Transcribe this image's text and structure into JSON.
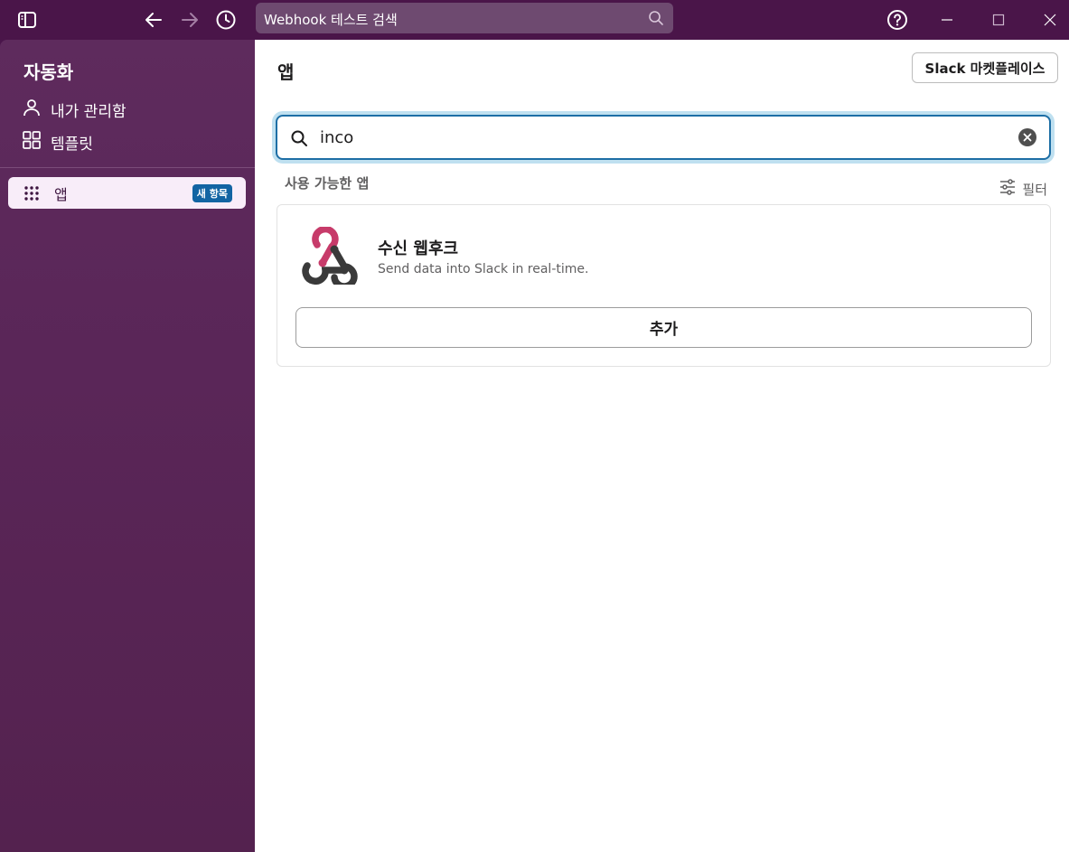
{
  "titlebar": {
    "search_text": "Webhook 테스트 검색",
    "icons": [
      "sidebar-toggle-icon",
      "back-arrow-icon",
      "forward-arrow-icon",
      "history-clock-icon",
      "help-icon",
      "minimize-icon",
      "maximize-icon",
      "close-icon"
    ]
  },
  "sidebar": {
    "title": "자동화",
    "items": [
      {
        "label": "내가 관리함",
        "icon": "person-icon"
      },
      {
        "label": "템플릿",
        "icon": "grid-icon"
      }
    ],
    "active_item": {
      "label": "앱",
      "badge": "새 항목",
      "icon": "dots-grid-icon"
    }
  },
  "main": {
    "title": "앱",
    "marketplace_button": "Slack 마켓플레이스",
    "search_value": "inco",
    "section_label": "사용 가능한 앱",
    "filter_label": "필터",
    "apps": [
      {
        "name": "수신 웹후크",
        "description": "Send data into Slack in real-time.",
        "add_label": "추가",
        "icon": "webhook-logo"
      }
    ]
  },
  "colors": {
    "brand_aubergine": "#4a154b",
    "active_item_bg": "#f8edf9",
    "badge_blue": "#1264a3",
    "focus_blue": "#1d6ea5"
  }
}
